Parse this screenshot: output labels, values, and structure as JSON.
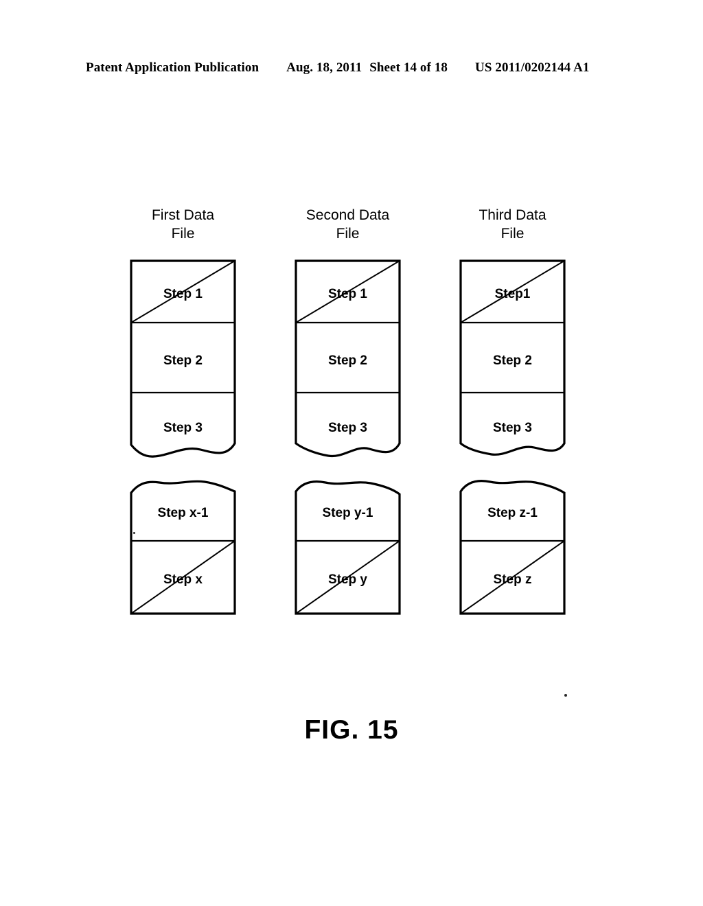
{
  "header": {
    "publication": "Patent Application Publication",
    "date": "Aug. 18, 2011",
    "sheet": "Sheet 14 of 18",
    "document_number": "US 2011/0202144 A1"
  },
  "figure": {
    "caption": "FIG. 15",
    "columns": [
      {
        "title": "First Data\nFile",
        "top_block": {
          "cells": [
            {
              "label": "Step 1",
              "diagonal": true
            },
            {
              "label": "Step 2",
              "diagonal": false
            },
            {
              "label": "Step 3",
              "diagonal": false
            }
          ],
          "torn_edge": "bottom"
        },
        "bottom_block": {
          "cells": [
            {
              "label": "Step x-1",
              "diagonal": false
            },
            {
              "label": "Step x",
              "diagonal": true
            }
          ],
          "torn_edge": "top"
        }
      },
      {
        "title": "Second Data\nFile",
        "top_block": {
          "cells": [
            {
              "label": "Step 1",
              "diagonal": true
            },
            {
              "label": "Step 2",
              "diagonal": false
            },
            {
              "label": "Step 3",
              "diagonal": false
            }
          ],
          "torn_edge": "bottom"
        },
        "bottom_block": {
          "cells": [
            {
              "label": "Step y-1",
              "diagonal": false
            },
            {
              "label": "Step y",
              "diagonal": true
            }
          ],
          "torn_edge": "top"
        }
      },
      {
        "title": "Third Data\nFile",
        "top_block": {
          "cells": [
            {
              "label": "Step1",
              "diagonal": true
            },
            {
              "label": "Step 2",
              "diagonal": false
            },
            {
              "label": "Step 3",
              "diagonal": false
            }
          ],
          "torn_edge": "bottom"
        },
        "bottom_block": {
          "cells": [
            {
              "label": "Step z-1",
              "diagonal": false
            },
            {
              "label": "Step z",
              "diagonal": true
            }
          ],
          "torn_edge": "top"
        }
      }
    ]
  },
  "colors": {
    "ink": "#000000",
    "paper": "#ffffff"
  }
}
